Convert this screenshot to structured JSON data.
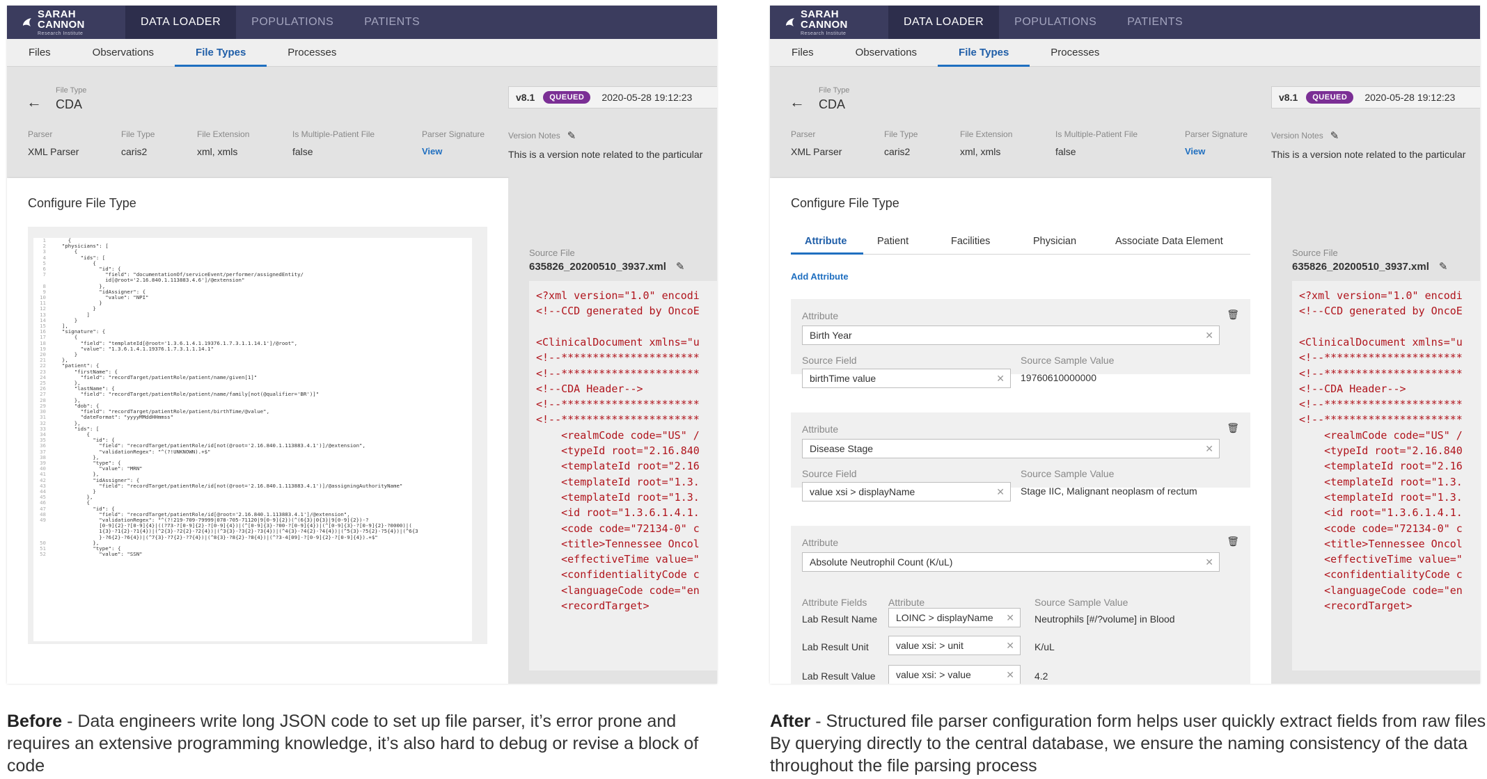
{
  "nav": {
    "logo_main": "SARAH CANNON",
    "logo_sub": "Research Institute",
    "items": [
      "DATA LOADER",
      "POPULATIONS",
      "PATIENTS"
    ]
  },
  "subnav": {
    "tabs": [
      "Files",
      "Observations",
      "File Types",
      "Processes"
    ]
  },
  "file_type": {
    "label": "File Type",
    "value": "CDA",
    "version": "v8.1",
    "status": "QUEUED",
    "timestamp": "2020-05-28 19:12:23",
    "meta": [
      {
        "label": "Parser",
        "value": "XML Parser"
      },
      {
        "label": "File Type",
        "value": "caris2"
      },
      {
        "label": "File Extension",
        "value": "xml, xmls"
      },
      {
        "label": "Is Multiple-Patient File",
        "value": "false"
      },
      {
        "label": "Parser Signature",
        "value": "View"
      }
    ],
    "version_notes_label": "Version Notes",
    "version_notes": "This is a version note related to the particular"
  },
  "config": {
    "title": "Configure File Type"
  },
  "source": {
    "label": "Source File",
    "filename": "635826_20200510_3937.xml",
    "xml_lines": [
      "<?xml version=\"1.0\" encodi",
      "<!--CCD generated by OncoE",
      "",
      "<ClinicalDocument xmlns=\"u",
      "<!--**********************",
      "<!--**********************",
      "<!--CDA Header-->",
      "<!--**********************",
      "<!--**********************",
      "    <realmCode code=\"US\" /",
      "    <typeId root=\"2.16.840",
      "    <templateId root=\"2.16",
      "    <templateId root=\"1.3.",
      "    <templateId root=\"1.3.",
      "    <id root=\"1.3.6.1.4.1.",
      "    <code code=\"72134-0\" c",
      "    <title>Tennessee Oncol",
      "    <effectiveTime value=\"",
      "    <confidentialityCode c",
      "    <languageCode code=\"en",
      "    <recordTarget>"
    ]
  },
  "json_lines": [
    {
      "n": "1",
      "t": "    {"
    },
    {
      "n": "2",
      "t": "  \"physicians\": ["
    },
    {
      "n": "3",
      "t": "      {"
    },
    {
      "n": "4",
      "t": "        \"ids\": ["
    },
    {
      "n": "5",
      "t": "            {"
    },
    {
      "n": "6",
      "t": "              \"id\": {"
    },
    {
      "n": "7",
      "t": "                \"field\": \"documentationOf/serviceEvent/performer/assignedEntity/"
    },
    {
      "n": "",
      "t": "                id[@root='2.16.840.1.113883.4.6']/@extension\""
    },
    {
      "n": "8",
      "t": "              },"
    },
    {
      "n": "9",
      "t": "              \"idAssigner\": {"
    },
    {
      "n": "10",
      "t": "                \"value\": \"NPI\""
    },
    {
      "n": "11",
      "t": "              }"
    },
    {
      "n": "12",
      "t": "            }"
    },
    {
      "n": "13",
      "t": "          ]"
    },
    {
      "n": "14",
      "t": "      }"
    },
    {
      "n": "15",
      "t": "  ],"
    },
    {
      "n": "16",
      "t": "  \"signature\": {"
    },
    {
      "n": "17",
      "t": "      {"
    },
    {
      "n": "18",
      "t": "        \"field\": \"templateId[@root='1.3.6.1.4.1.19376.1.7.3.1.1.14.1']/@root\","
    },
    {
      "n": "19",
      "t": "        \"value\": \"1.3.6.1.4.1.19376.1.7.3.1.1.14.1\""
    },
    {
      "n": "20",
      "t": "      }"
    },
    {
      "n": "21",
      "t": "  },"
    },
    {
      "n": "22",
      "t": "  \"patient\": {"
    },
    {
      "n": "23",
      "t": "      \"firstName\": {"
    },
    {
      "n": "24",
      "t": "        \"field\": \"recordTarget/patientRole/patient/name/given[1]\""
    },
    {
      "n": "25",
      "t": "      },"
    },
    {
      "n": "26",
      "t": "      \"lastName\": {"
    },
    {
      "n": "27",
      "t": "        \"field\": \"recordTarget/patientRole/patient/name/family[not(@qualifier='BR')]\""
    },
    {
      "n": "28",
      "t": "      },"
    },
    {
      "n": "29",
      "t": "      \"dob\": {"
    },
    {
      "n": "30",
      "t": "        \"field\": \"recordTarget/patientRole/patient/birthTime/@value\","
    },
    {
      "n": "31",
      "t": "        \"dateFormat\": \"yyyyMMddHHmmss\""
    },
    {
      "n": "32",
      "t": "      },"
    },
    {
      "n": "33",
      "t": "      \"ids\": ["
    },
    {
      "n": "34",
      "t": "          {"
    },
    {
      "n": "35",
      "t": "            \"id\": {"
    },
    {
      "n": "36",
      "t": "              \"field\": \"recordTarget/patientRole/id[not(@root='2.16.840.1.113883.4.1')]/@extension\","
    },
    {
      "n": "37",
      "t": "              \"validationRegex\": \"^(?!UNKNOWN).+$\""
    },
    {
      "n": "38",
      "t": "            },"
    },
    {
      "n": "39",
      "t": "            \"type\": {"
    },
    {
      "n": "40",
      "t": "              \"value\": \"MRN\""
    },
    {
      "n": "41",
      "t": "            },"
    },
    {
      "n": "42",
      "t": "            \"idAssigner\": {"
    },
    {
      "n": "43",
      "t": "              \"field\": \"recordTarget/patientRole/id[not(@root='2.16.840.1.113883.4.1')]/@assigningAuthorityName\""
    },
    {
      "n": "44",
      "t": "            }"
    },
    {
      "n": "45",
      "t": "          },"
    },
    {
      "n": "46",
      "t": "          {"
    },
    {
      "n": "47",
      "t": "            \"id\": {"
    },
    {
      "n": "48",
      "t": "              \"field\": \"recordTarget/patientRole/id[@root='2.16.840.1.113883.4.1']/@extension\","
    },
    {
      "n": "49",
      "t": "              \"validationRegex\": \"^(?!219-709-79999|078-705-71120|9[0-9]{2})(^(6{3}|0{3}|9[0-9]{2})-?"
    },
    {
      "n": "",
      "t": "              [0-9]{2}-?[0-9]{4}|((?73-?[0-9]{2}-?[0-9]{4})|(^[0-9]{3}-?00-?[0-9]{4})|(^[0-9]{3}-?[0-9]{2}-?0000)|("
    },
    {
      "n": "",
      "t": "              1{3}-?1{2}-?1{4})|(^2{3}-?2{2}-?2{4})|(^3{3}-?3{2}-?3{4})|(^4{3}-?4{2}-?4{4})|(^5{3}-?5{2}-?5{4})|(^6{3"
    },
    {
      "n": "",
      "t": "              }-?6{2}-?6{4})|(^7{3}-?7{2}-?7{4})|(^8{3}-?8{2}-?8{4})|(^?3-4[09]-?[0-9]{2}-?[0-9]{4}).+$\""
    },
    {
      "n": "50",
      "t": "            },"
    },
    {
      "n": "51",
      "t": "            \"type\": {"
    },
    {
      "n": "52",
      "t": "              \"value\": \"SSN\""
    }
  ],
  "form": {
    "tabs": [
      "Attribute",
      "Patient",
      "Facilities",
      "Physician",
      "Associate Data Element"
    ],
    "add_label": "Add Attribute",
    "attribute_label": "Attribute",
    "source_field_label": "Source Field",
    "sample_value_label": "Source Sample Value",
    "attributes": [
      {
        "name": "Birth Year",
        "source_field": "birthTime value",
        "sample": "19760610000000"
      },
      {
        "name": "Disease Stage",
        "source_field": "value xsi > displayName",
        "sample": "Stage IIC, Malignant neoplasm of rectum"
      }
    ],
    "complex_attribute": {
      "name": "Absolute Neutrophil Count (K/uL)",
      "fields_label": "Attribute Fields",
      "attr_col_label": "Attribute",
      "sample_col_label": "Source Sample Value",
      "rows": [
        {
          "field": "Lab Result Name",
          "attribute": "LOINC > displayName",
          "sample": "Neutrophils [#/?volume] in Blood"
        },
        {
          "field": "Lab Result Unit",
          "attribute": "value xsi: > unit",
          "sample": "K/uL"
        },
        {
          "field": "Lab Result Value",
          "attribute": "value xsi: > value",
          "sample": "4.2"
        }
      ]
    }
  },
  "captions": {
    "before_title": "Before",
    "before_text": " - Data engineers write long JSON code to set up file parser, it’s error prone and requires an extensive programming knowledge, it’s also hard to debug or revise a block of code",
    "after_title": "After",
    "after_text": " - Structured file parser configuration form helps user quickly extract fields from raw files. By querying directly to the central database, we ensure the naming consistency of the data throughout the file parsing process"
  },
  "colors": {
    "nav_bg": "#3b3c5e",
    "nav_active": "#2d2e4c",
    "accent": "#1f6fc0",
    "badge": "#7b2f95",
    "xml": "#b0141c"
  }
}
